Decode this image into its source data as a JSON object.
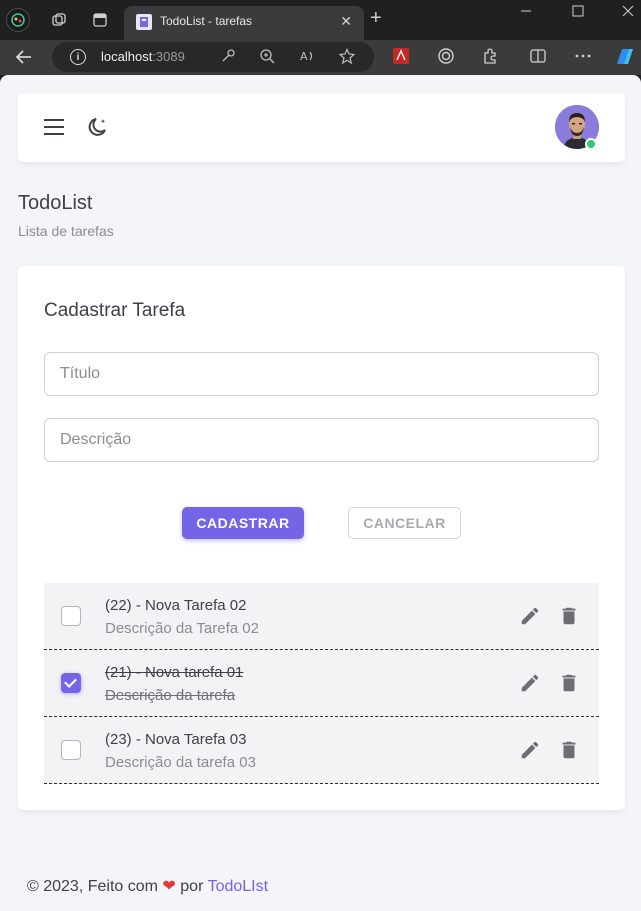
{
  "browser": {
    "tab_title": "TodoList - tarefas",
    "tab_close": "✕",
    "new_tab": "+",
    "address_host": "localhost",
    "address_port": ":3089"
  },
  "header": {
    "avatar_alt": "user avatar"
  },
  "page": {
    "title": "TodoList",
    "subtitle": "Lista de tarefas"
  },
  "form": {
    "title": "Cadastrar Tarefa",
    "title_placeholder": "Título",
    "description_placeholder": "Descrição",
    "submit_label": "CADASTRAR",
    "cancel_label": "CANCELAR"
  },
  "tasks": [
    {
      "title": "(22) - Nova Tarefa 02",
      "description": "Descrição da Tarefa 02",
      "done": false
    },
    {
      "title": "(21) - Nova tarefa 01",
      "description": "Descrição da tarefa",
      "done": true
    },
    {
      "title": "(23) - Nova Tarefa 03",
      "description": "Descrição da tarefa 03",
      "done": false
    }
  ],
  "footer": {
    "prefix": "© 2023, Feito com",
    "heart": "❤",
    "by": "por",
    "link": "TodoLIst"
  },
  "colors": {
    "primary": "#7365e6",
    "online": "#2ecc71",
    "heart": "#e53935"
  }
}
